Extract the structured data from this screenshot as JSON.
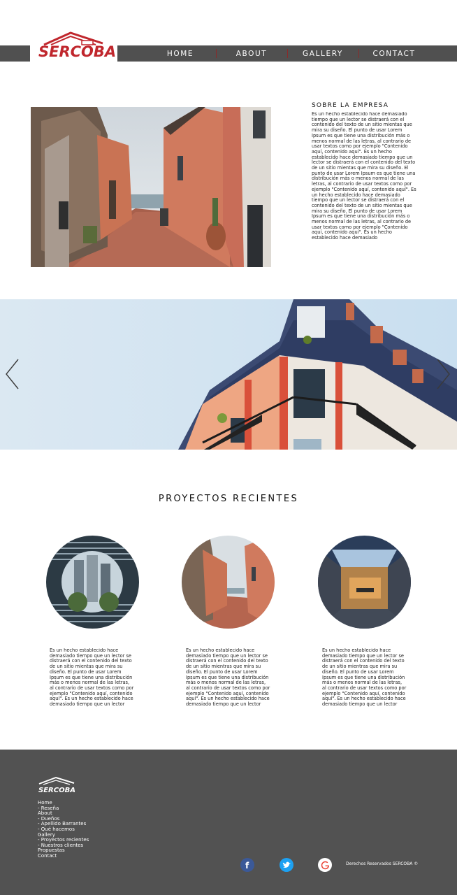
{
  "brand": {
    "name": "SERCOBA",
    "color": "#c0272d"
  },
  "nav": {
    "items": [
      {
        "label": "HOME"
      },
      {
        "label": "ABOUT"
      },
      {
        "label": "GALLERY"
      },
      {
        "label": "CONTACT"
      }
    ]
  },
  "about": {
    "title": "SOBRE LA EMPRESA",
    "text": "Es un hecho establecido hace demasiado tiempo que un lector se distraerá con el contenido del texto de un sitio mientas que mira su diseño. El punto de usar Lorem Ipsum es que tiene una distribución más o menos normal de las letras, al contrario de usar textos como por ejemplo \"Contenido aquí, contenido aquí\". Es un hecho establecido hace demasiado tiempo que un lector se distraerá con el contenido del texto de un sitio mientas que mira su diseño. El punto de usar Lorem Ipsum es que tiene una distribución más o menos normal de las letras, al contrario de usar textos como por ejemplo \"Contenido aquí, contenido aquí\". Es un hecho establecido hace demasiado tiempo que un lector se distraerá con el contenido del texto de un sitio mientas que mira su diseño. El punto de usar Lorem Ipsum es que tiene una distribución más o menos normal de las letras, al contrario de usar textos como por ejemplo \"Contenido aquí, contenido aquí\". Es un hecho establecido hace demasiado"
  },
  "projects": {
    "title": "PROYECTOS RECIENTES",
    "items": [
      {
        "text": "Es un hecho establecido hace demasiado tiempo que un lector se distraerá con el contenido del texto de un sitio mientas que mira su diseño. El punto de usar Lorem Ipsum es que tiene una distribución más o menos normal de las letras, al contrario de usar textos como por ejemplo \"Contenido aquí, contenido aquí\". Es un hecho establecido hace demasiado tiempo que un lector"
      },
      {
        "text": "Es un hecho establecido hace demasiado tiempo que un lector se distraerá con el contenido del texto de un sitio mientras que mira su diseño. El punto de usar Lorem Ipsum es que tiene una distribución más o menos normal de las letras, al contrario de usar textos como por ejemplo \"Contenido aquí, contenido aquí\". Es un hecho establecido hace demasiado tiempo que un lector"
      },
      {
        "text": "Es un hecho establecido hace demasiado tiempo que un lector se distraerá con el contenido del texto de un sitio mientras que mira su diseño. El punto de usar Lorem Ipsum es que tiene una distribución más o menos normal de las letras, al contrario de usar textos como por ejemplo \"Contenido aquí, contenido aquí\". Es un hecho establecido hace demasiado tiempo que un lector"
      }
    ]
  },
  "footer": {
    "menu": [
      "Home",
      "- Reseña",
      "About",
      "- Dueños",
      "- Apellido Barrantes",
      "- Qué hacemos",
      "Gallery",
      "- Proyectos recientes",
      "- Nuestros clientes",
      "Propuestas",
      "Contact"
    ],
    "copyright": "Derechos Reservados SERCOBA ©",
    "social": [
      {
        "icon": "facebook-icon",
        "color": "#3b5998"
      },
      {
        "icon": "twitter-icon",
        "color": "#1da1f2"
      },
      {
        "icon": "google-icon",
        "color": "#ffffff"
      }
    ]
  }
}
